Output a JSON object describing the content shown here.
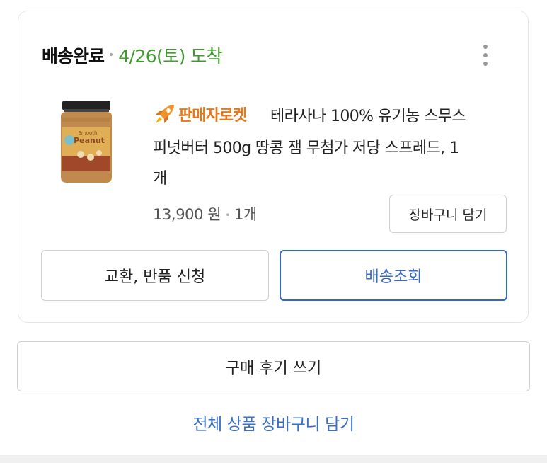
{
  "order": {
    "status_label": "배송완료",
    "arrival_text": "4/26(토) 도착",
    "more_icon": "more-vertical-icon"
  },
  "product": {
    "brand_badge": "판매자로켓",
    "badge_icon": "rocket-icon",
    "name_line1": "테라사나 100% 유기농 스무스",
    "name_line2": "피넛버터 500g 땅콩 잼 무첨가 저당 스프레드, 1",
    "name_line3": "개",
    "price": "13,900 원",
    "quantity": "1개",
    "jar_label_top": "Smooth",
    "jar_label_main": "Peanut"
  },
  "buttons": {
    "add_to_cart": "장바구니 담기",
    "exchange_return": "교환, 반품 신청",
    "track_delivery": "배송조회",
    "write_review": "구매 후기 쓰기",
    "add_all_to_cart": "전체 상품 장바구니 담기"
  },
  "colors": {
    "arrival_green": "#3f9b2e",
    "link_blue": "#3a6fc7",
    "rocket_orange": "#e8771a"
  }
}
